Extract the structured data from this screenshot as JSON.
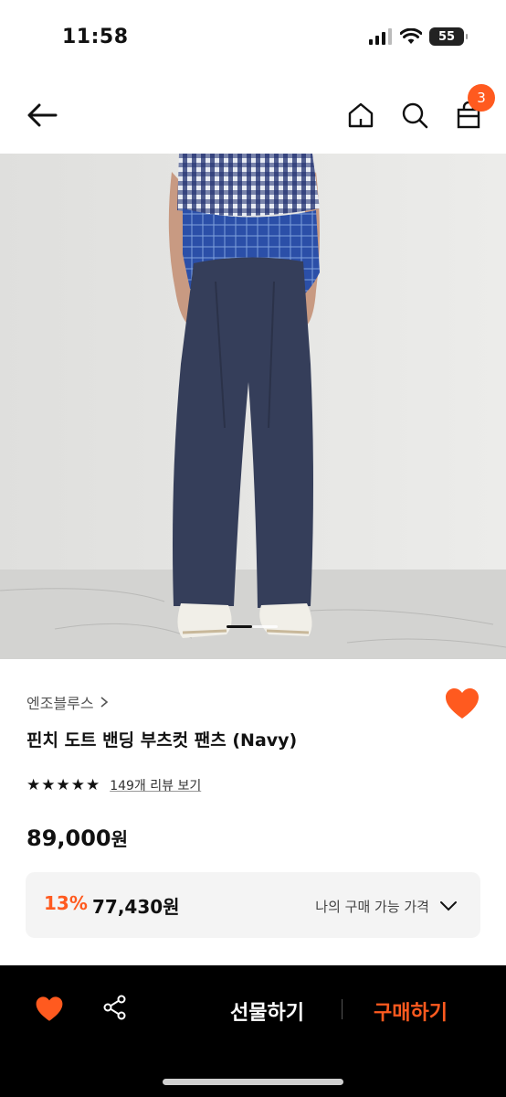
{
  "status": {
    "time": "11:58",
    "battery": "55"
  },
  "nav": {
    "cart_count": "3"
  },
  "product": {
    "brand": "엔조블루스",
    "title": "핀치 도트 밴딩 부츠컷 팬츠 (Navy)",
    "stars": "★★★★★",
    "rating": 5,
    "review_link": "149개 리뷰 보기",
    "price": "89,000",
    "price_unit": "원"
  },
  "member_price": {
    "discount_rate": "13%",
    "price": "77,430원",
    "label": "나의 구매 가능 가격"
  },
  "bottom_bar": {
    "gift_label": "선물하기",
    "buy_label": "구매하기"
  },
  "colors": {
    "accent": "#ff5a1f",
    "bottom_bar_bg": "#000000"
  },
  "icons": [
    "back-arrow-icon",
    "home-icon",
    "search-icon",
    "shopping-bag-icon",
    "heart-icon",
    "chevron-right-icon",
    "chevron-down-icon",
    "share-icon"
  ]
}
